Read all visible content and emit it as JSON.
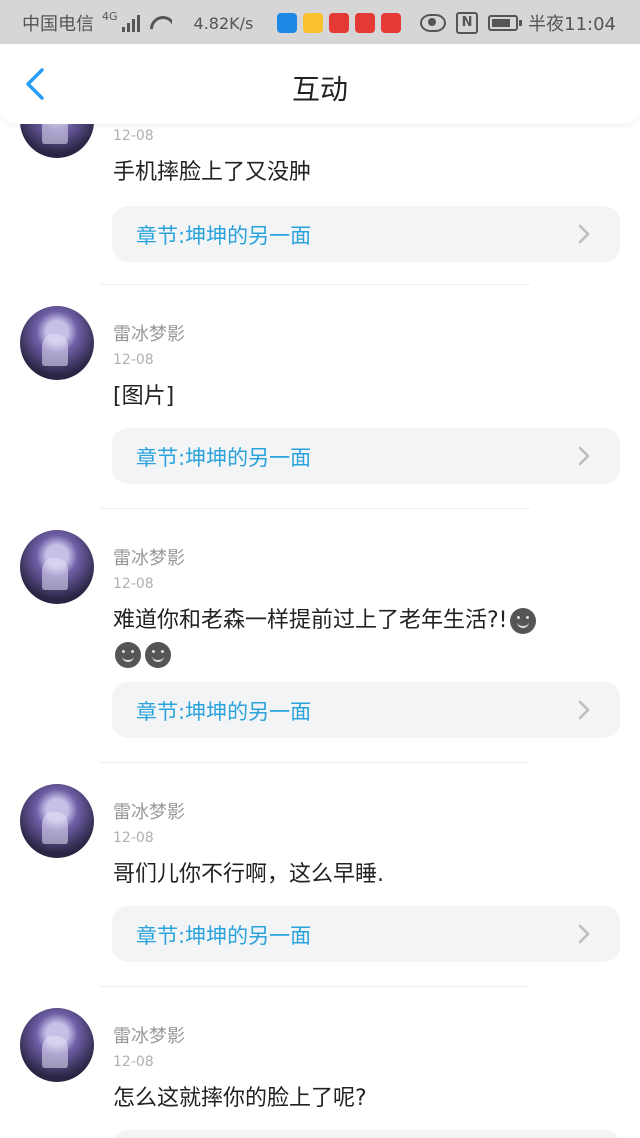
{
  "status_bar": {
    "carrier": "中国电信",
    "network": "4G",
    "speed": "4.82K/s",
    "time": "半夜11:04",
    "app_icon_colors": [
      "#1e88e5",
      "#fbc02d",
      "#e53935",
      "#e53935",
      "#e53935"
    ],
    "icons": [
      "signal-icon",
      "wifi-icon",
      "eye-icon",
      "nfc-icon",
      "battery-icon"
    ]
  },
  "header": {
    "title": "互动",
    "back_icon": "chevron-left-icon",
    "accent": "#2a9df4"
  },
  "comments": [
    {
      "username": "",
      "date": "12-08",
      "text": "手机摔脸上了又没肿",
      "chapter": "章节:坤坤的另一面"
    },
    {
      "username": "雷冰梦影",
      "date": "12-08",
      "text": "[图片]",
      "chapter": "章节:坤坤的另一面"
    },
    {
      "username": "雷冰梦影",
      "date": "12-08",
      "text": "难道你和老森一样提前过上了老年生活?!",
      "emoji_count": 3,
      "chapter": "章节:坤坤的另一面"
    },
    {
      "username": "雷冰梦影",
      "date": "12-08",
      "text": "哥们儿你不行啊，这么早睡.",
      "chapter": "章节:坤坤的另一面"
    },
    {
      "username": "雷冰梦影",
      "date": "12-08",
      "text": "怎么这就摔你的脸上了呢?",
      "chapter": ""
    }
  ],
  "colors": {
    "chapter_text": "#2aa3dc",
    "chapter_bg": "#f3f4f6",
    "username": "#999999",
    "date": "#b0b0b0"
  }
}
